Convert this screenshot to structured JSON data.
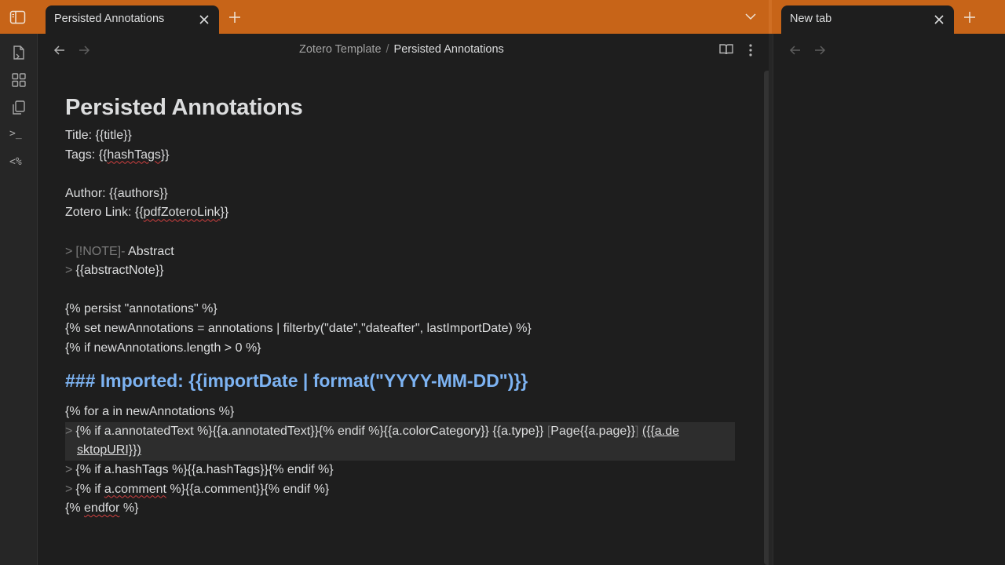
{
  "tabs": {
    "active_label": "Persisted Annotations",
    "new_label": "New tab"
  },
  "breadcrumb": {
    "parent": "Zotero Template",
    "separator": "/",
    "current": "Persisted Annotations"
  },
  "ribbon": {
    "terminal_icon_text": ">_",
    "templater_icon_text": "<%"
  },
  "doc": {
    "title": "Persisted Annotations",
    "line_title": "Title: {{title}}",
    "line_tags_pre": "Tags: {{",
    "line_tags_word": "hashTags",
    "line_tags_post": "}}",
    "line_author": "Author: {{authors}}",
    "line_zotero_pre": "Zotero Link: {{",
    "line_zotero_word": "pdfZoteroLink",
    "line_zotero_post": "}}",
    "quote_mark": ">",
    "callout_type": "[!NOTE]-",
    "callout_title": "Abstract",
    "callout_body": "{{abstractNote}}",
    "line_persist": "{% persist \"annotations\" %}",
    "line_set": "{% set newAnnotations = annotations | filterby(\"date\",\"dateafter\", lastImportDate) %}",
    "line_if": "{% if newAnnotations.length > 0 %}",
    "heading3": "### Imported: {{importDate | format(\"YYYY-MM-DD\")}}",
    "line_for": "{% for a in newAnnotations %}",
    "active_line1_main": "{% if a.annotatedText %}{{a.annotatedText}}{% endif %}{{a.colorCategory}} {{a.type}} ",
    "active_bracket_open": "[",
    "active_page": "Page{{a.page}}",
    "active_bracket_close": "]",
    "active_link_start": "({{a.de",
    "active_line2": "sktopURI}})",
    "line_hashtags": "{% if a.hashTags %}{{a.hashTags}}{% endif %}",
    "line_comment_pre": "{% if ",
    "line_comment_word": "a.comment",
    "line_comment_post": " %}{{a.comment}}{% endif %}",
    "line_endfor_pre": "{% ",
    "line_endfor_word": "endfor",
    "line_endfor_post": " %}"
  },
  "colors": {
    "accent": "#c76418",
    "heading3": "#7db3f2",
    "background": "#1e1e1e"
  }
}
